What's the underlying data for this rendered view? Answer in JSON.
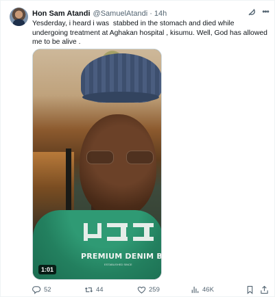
{
  "tweet": {
    "author_name": "Hon Sam Atandi",
    "handle": "@SamuelAtandi",
    "separator": "·",
    "time": "14h",
    "text": "Yesderday, i heard i was  stabbed in the stomach and died while undergoing treatment at Aghakan hospital , kisumu. Well, God has allowed me to be alive ."
  },
  "media": {
    "duration": "1:01",
    "shirt_text": "PREMIUM DENIM B",
    "shirt_sub": "ESTABLISHED SINCE"
  },
  "icons": {
    "grok": "grok-icon",
    "more": "more-icon",
    "reply": "reply-icon",
    "repost": "repost-icon",
    "like": "heart-icon",
    "views": "views-icon",
    "bookmark": "bookmark-icon",
    "share": "share-icon"
  },
  "actions": {
    "replies": "52",
    "reposts": "44",
    "likes": "259",
    "views": "46K"
  },
  "colors": {
    "text": "#0f1419",
    "muted": "#536471",
    "border": "#eff3f4"
  }
}
